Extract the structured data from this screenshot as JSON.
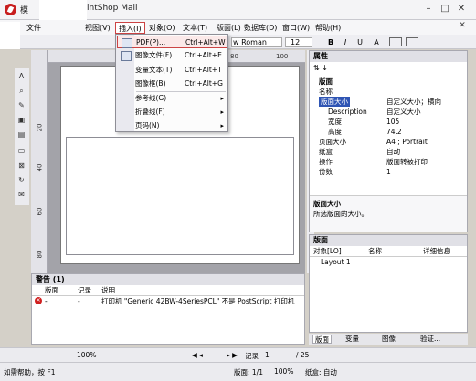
{
  "window": {
    "title_prefix": "模",
    "title_suffix": "intShop Mail",
    "minimize": "–",
    "restore": "□",
    "close": "✕"
  },
  "menu": {
    "items": [
      "文件",
      "视图(V)",
      "插入(I)",
      "对象(O)",
      "文本(T)",
      "版面(L)",
      "数据库(D)",
      "窗口(W)",
      "帮助(H)"
    ],
    "close_glyph": "✕"
  },
  "toolbar": {
    "font_name": "w Roman",
    "font_size": "12",
    "bold": "B",
    "italic": "I",
    "underline": "U",
    "font_color": "A"
  },
  "insert_menu": {
    "items": [
      {
        "label": "PDF(P)...",
        "shortcut": "Ctrl+Alt+W"
      },
      {
        "label": "图像文件(F)...",
        "shortcut": "Ctrl+Alt+E"
      },
      {
        "label": "变量文本(T)",
        "shortcut": "Ctrl+Alt+T"
      },
      {
        "label": "图像框(B)",
        "shortcut": "Ctrl+Alt+G"
      },
      {
        "label": "参考线(G)"
      },
      {
        "label": "折叠线(F)"
      },
      {
        "label": "页码(N)"
      }
    ],
    "submenu_arrow": "▸"
  },
  "ruler": {
    "h_labels": [
      "80",
      "100"
    ],
    "v_labels": [
      "20",
      "40",
      "60",
      "80"
    ]
  },
  "properties": {
    "title": "属性",
    "rows": [
      {
        "key": "版面",
        "value": ""
      },
      {
        "key": "名称",
        "value": ""
      },
      {
        "key": "版面大小",
        "value": "自定义大小；横向"
      },
      {
        "key": "Description",
        "value": "自定义大小"
      },
      {
        "key": "宽度",
        "value": "105"
      },
      {
        "key": "高度",
        "value": "74.2"
      },
      {
        "key": "页面大小",
        "value": "A4 ; Portrait"
      },
      {
        "key": "纸盒",
        "value": "自动"
      },
      {
        "key": "操作",
        "value": "版面转被打印"
      },
      {
        "key": "份数",
        "value": "1"
      }
    ],
    "desc_title": "版面大小",
    "desc_text": "所选版面的大小。"
  },
  "layer_panel": {
    "title": "版面",
    "columns": [
      "对象[LO]",
      "名称",
      "详细信息"
    ],
    "rows": [
      "Layout 1"
    ]
  },
  "bottom_tabs": [
    "版面",
    "变量",
    "图像",
    "验证..."
  ],
  "warning_panel": {
    "title": "警告 (1)",
    "columns": [
      "版面",
      "记录",
      "说明"
    ],
    "row": {
      "page": "-",
      "record": "-",
      "description": "打印机 \"Generic 42BW-4SeriesPCL\" 不是 PostScript 打印机"
    }
  },
  "navbar": {
    "zoom": "100%",
    "record_label": "记录",
    "record_value": "1",
    "record_total": "/ 25"
  },
  "statusbar": {
    "help": "如需帮助，按 F1",
    "page": "版面: 1/1",
    "zoom": "100%",
    "tray": "纸盒: 自动"
  }
}
